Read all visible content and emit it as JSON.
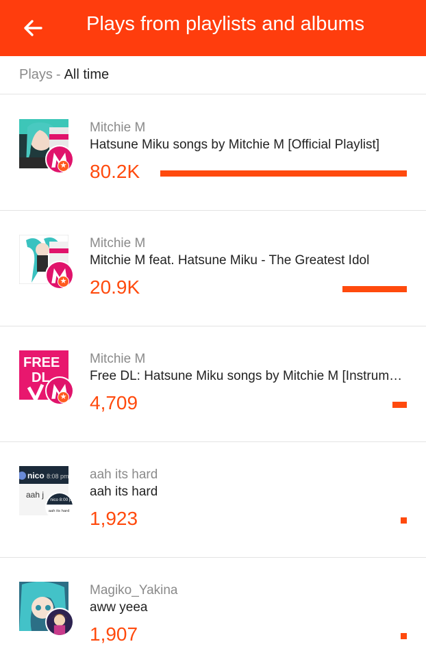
{
  "appbar": {
    "title": "Plays from playlists and albums",
    "back_icon": "arrow-left-icon"
  },
  "subheader": {
    "label": "Plays",
    "separator": "-",
    "range": "All time"
  },
  "colors": {
    "accent": "#ff3d0d",
    "play_count": "#ff4a0d",
    "muted_text": "#8a8a8a"
  },
  "items": [
    {
      "user": "Mitchie M",
      "title": "Hatsune Miku songs by Mitchie M [Official Playlist]",
      "plays": "80.2K",
      "plays_value": 80200,
      "pro": true
    },
    {
      "user": "Mitchie M",
      "title": "Mitchie M feat. Hatsune Miku - The Greatest Idol",
      "plays": "20.9K",
      "plays_value": 20900,
      "pro": true
    },
    {
      "user": "Mitchie M",
      "title": "Free DL: Hatsune Miku songs by Mitchie M [Instrumental]",
      "plays": "4,709",
      "plays_value": 4709,
      "pro": true,
      "cover_text": [
        "FREE",
        "DL"
      ]
    },
    {
      "user": "aah its hard",
      "title": "aah its hard",
      "plays": "1,923",
      "plays_value": 1923,
      "pro": false,
      "cover_text": [
        "nico",
        "8:08 pm",
        "aah j",
        "nico 8:00 p",
        "aah its hard"
      ]
    },
    {
      "user": "Magiko_Yakina",
      "title": "aww yeea",
      "plays": "1,907",
      "plays_value": 1907,
      "pro": false
    }
  ]
}
